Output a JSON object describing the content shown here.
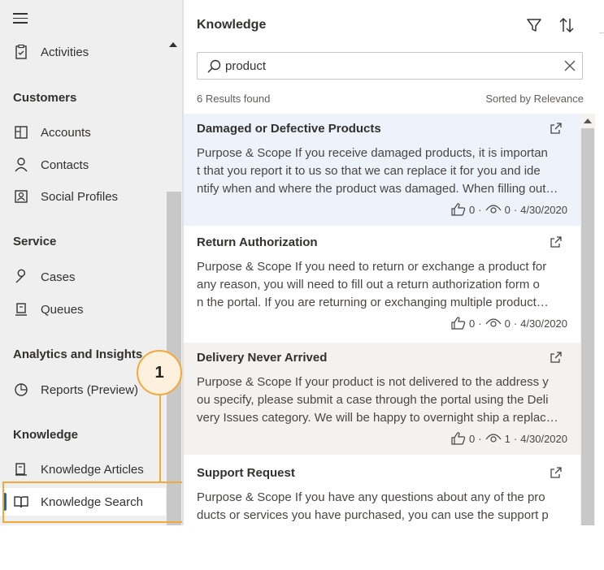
{
  "nav": {
    "activities": "Activities",
    "groups": {
      "customers": "Customers",
      "service": "Service",
      "analytics": "Analytics and Insights",
      "knowledge": "Knowledge"
    },
    "items": {
      "accounts": "Accounts",
      "contacts": "Contacts",
      "social_profiles": "Social Profiles",
      "cases": "Cases",
      "queues": "Queues",
      "reports": "Reports (Preview)",
      "knowledge_articles": "Knowledge Articles",
      "knowledge_search": "Knowledge Search"
    },
    "selected": "knowledge_search"
  },
  "callout": {
    "number": "1",
    "color": "#f2a93b"
  },
  "pane": {
    "title": "Knowledge",
    "search": {
      "value": "product",
      "placeholder": ""
    },
    "results_count": "6 Results found",
    "sorted_by": "Sorted by Relevance",
    "results": [
      {
        "title": "Damaged or Defective Products",
        "lines": [
          "Purpose & Scope If you receive damaged products, it is importan",
          "t that you report it to us so that we can replace it for you and ide",
          "ntify when and where the product was damaged. When filling out…"
        ],
        "likes": "0",
        "views": "0",
        "date": "4/30/2020"
      },
      {
        "title": "Return Authorization",
        "lines": [
          "Purpose & Scope If you need to return or exchange a product for",
          "any reason, you will need to fill out a return authorization form o",
          "n the portal. If you are returning or exchanging multiple product…"
        ],
        "likes": "0",
        "views": "0",
        "date": "4/30/2020"
      },
      {
        "title": "Delivery Never Arrived",
        "lines": [
          "Purpose & Scope If your product is not delivered to the address y",
          "ou specify, please submit a case through the portal using the Deli",
          "very Issues category. We will be happy to overnight ship a replac…"
        ],
        "likes": "0",
        "views": "1",
        "date": "4/30/2020"
      },
      {
        "title": "Support Request",
        "lines": [
          "Purpose & Scope If you have any questions about any of the pro",
          "ducts or services you have purchased, you can use the support p"
        ],
        "likes": "",
        "views": "",
        "date": ""
      }
    ]
  },
  "colors": {
    "accent": "#0f6cbd",
    "highlight_row": "#eef3fb",
    "callout": "#f2a93b"
  }
}
